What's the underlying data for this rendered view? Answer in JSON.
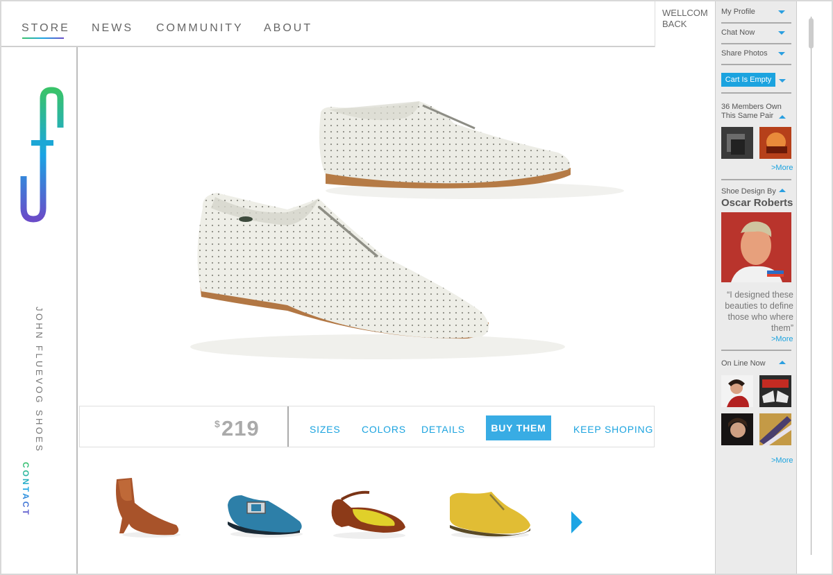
{
  "nav": {
    "items": [
      "STORE",
      "NEWS",
      "COMMUNITY",
      "ABOUT"
    ],
    "welcome": "WELLCOM BACK"
  },
  "sidebar": {
    "brand": "JOHN FLUEVOG SHOES",
    "contact": "CONTACT"
  },
  "product": {
    "currency": "$",
    "price": "219",
    "links": [
      "SIZES",
      "COLORS",
      "DETAILS"
    ],
    "buy_label": "BUY THEM",
    "keep_label": "KEEP SHOPING"
  },
  "account": {
    "my_profile": "My Profile",
    "chat_now": "Chat Now",
    "share_photos": "Share Photos",
    "cart": "Cart Is Empty"
  },
  "members": {
    "title": "36 Members Own This Same Pair",
    "more": ">More"
  },
  "design": {
    "label": "Shoe Design By",
    "designer": "Oscar Roberts",
    "quote": "“I designed these beauties to define those who where them”",
    "more": ">More"
  },
  "online": {
    "title": "On Line Now",
    "more": ">More"
  },
  "colors": {
    "accent": "#1ba3df",
    "gradient_green": "#39c36a",
    "gradient_blue": "#1aa4e4",
    "gradient_purple": "#6a4cc8"
  }
}
